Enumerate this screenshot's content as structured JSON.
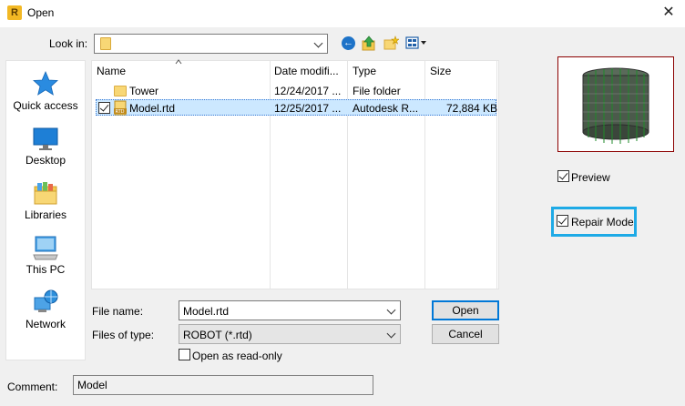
{
  "window": {
    "title": "Open",
    "app_icon_letter": "R"
  },
  "toolbar": {
    "look_in_label": "Look in:",
    "look_in_value": "",
    "icons": [
      "back-icon",
      "up-folder-icon",
      "new-folder-icon",
      "views-menu-icon"
    ]
  },
  "places": [
    {
      "label": "Quick access",
      "icon": "star-icon"
    },
    {
      "label": "Desktop",
      "icon": "desktop-icon"
    },
    {
      "label": "Libraries",
      "icon": "libraries-icon"
    },
    {
      "label": "This PC",
      "icon": "computer-icon"
    },
    {
      "label": "Network",
      "icon": "network-icon"
    }
  ],
  "file_list": {
    "columns": [
      "Name",
      "Date modifi...",
      "Type",
      "Size"
    ],
    "rows": [
      {
        "name": "Tower",
        "date": "12/24/2017 ...",
        "type": "File folder",
        "size": "",
        "icon": "folder-icon",
        "selected": false
      },
      {
        "name": "Model.rtd",
        "date": "12/25/2017 ...",
        "type": "Autodesk R...",
        "size": "72,884 KB",
        "icon": "rtd-file-icon",
        "selected": true
      }
    ]
  },
  "fields": {
    "file_name_label": "File name:",
    "file_name_value": "Model.rtd",
    "file_type_label": "Files of type:",
    "file_type_value": "ROBOT (*.rtd)",
    "read_only_label": "Open as read-only",
    "read_only_checked": false
  },
  "buttons": {
    "open": "Open",
    "cancel": "Cancel"
  },
  "comment": {
    "label": "Comment:",
    "value": "Model"
  },
  "preview": {
    "preview_label": "Preview",
    "preview_checked": true,
    "repair_label": "Repair Mode",
    "repair_checked": true,
    "highlight_color": "#1eaae6",
    "border_color": "#8b0000"
  },
  "colors": {
    "selection": "#cce8ff",
    "accent": "#0078d7"
  }
}
